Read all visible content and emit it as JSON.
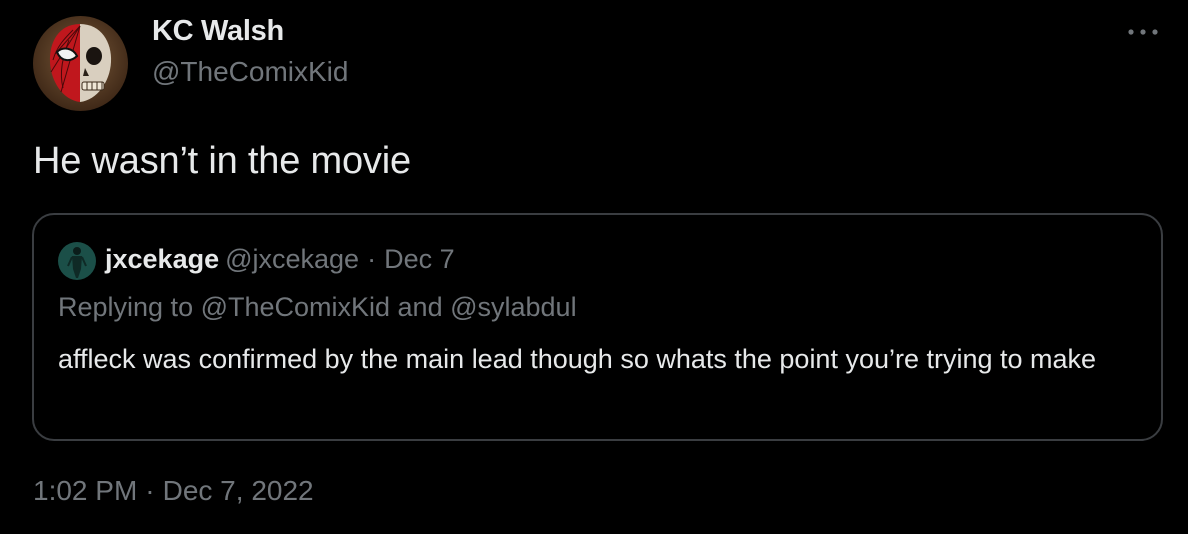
{
  "tweet": {
    "author": {
      "name": "KC Walsh",
      "handle": "@TheComixKid",
      "avatar_icon": "spiderman-skull-avatar"
    },
    "text": "He wasn’t in the movie",
    "more_icon": "more-horizontal-icon",
    "time": "1:02 PM",
    "separator": "·",
    "date": "Dec 7, 2022"
  },
  "quote": {
    "author_name": "jxcekage",
    "author_handle": "@jxcekage",
    "separator": "·",
    "date": "Dec 7",
    "avatar_icon": "figure-avatar",
    "replying_to": "Replying to @TheComixKid and @sylabdul",
    "body": "affleck was confirmed by the main lead though so whats the point you’re trying to make"
  },
  "colors": {
    "background": "#000000",
    "primary_text": "#e7e9ea",
    "secondary_text": "#71767b",
    "border": "#3a3d41"
  }
}
